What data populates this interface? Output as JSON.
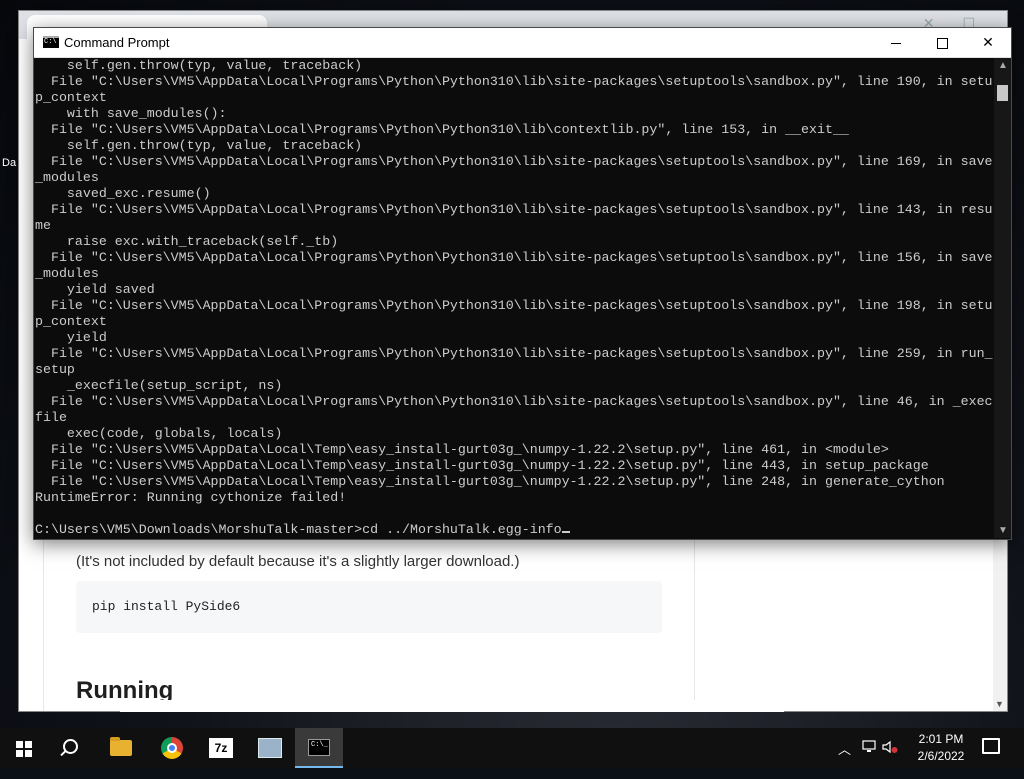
{
  "cmd": {
    "title": "Command Prompt",
    "lines": [
      "    self.gen.throw(typ, value, traceback)",
      "  File \"C:\\Users\\VM5\\AppData\\Local\\Programs\\Python\\Python310\\lib\\site-packages\\setuptools\\sandbox.py\", line 190, in setu",
      "p_context",
      "    with save_modules():",
      "  File \"C:\\Users\\VM5\\AppData\\Local\\Programs\\Python\\Python310\\lib\\contextlib.py\", line 153, in __exit__",
      "    self.gen.throw(typ, value, traceback)",
      "  File \"C:\\Users\\VM5\\AppData\\Local\\Programs\\Python\\Python310\\lib\\site-packages\\setuptools\\sandbox.py\", line 169, in save",
      "_modules",
      "    saved_exc.resume()",
      "  File \"C:\\Users\\VM5\\AppData\\Local\\Programs\\Python\\Python310\\lib\\site-packages\\setuptools\\sandbox.py\", line 143, in resu",
      "me",
      "    raise exc.with_traceback(self._tb)",
      "  File \"C:\\Users\\VM5\\AppData\\Local\\Programs\\Python\\Python310\\lib\\site-packages\\setuptools\\sandbox.py\", line 156, in save",
      "_modules",
      "    yield saved",
      "  File \"C:\\Users\\VM5\\AppData\\Local\\Programs\\Python\\Python310\\lib\\site-packages\\setuptools\\sandbox.py\", line 198, in setu",
      "p_context",
      "    yield",
      "  File \"C:\\Users\\VM5\\AppData\\Local\\Programs\\Python\\Python310\\lib\\site-packages\\setuptools\\sandbox.py\", line 259, in run_",
      "setup",
      "    _execfile(setup_script, ns)",
      "  File \"C:\\Users\\VM5\\AppData\\Local\\Programs\\Python\\Python310\\lib\\site-packages\\setuptools\\sandbox.py\", line 46, in _exec",
      "file",
      "    exec(code, globals, locals)",
      "  File \"C:\\Users\\VM5\\AppData\\Local\\Temp\\easy_install-gurt03g_\\numpy-1.22.2\\setup.py\", line 461, in <module>",
      "  File \"C:\\Users\\VM5\\AppData\\Local\\Temp\\easy_install-gurt03g_\\numpy-1.22.2\\setup.py\", line 443, in setup_package",
      "  File \"C:\\Users\\VM5\\AppData\\Local\\Temp\\easy_install-gurt03g_\\numpy-1.22.2\\setup.py\", line 248, in generate_cython",
      "RuntimeError: Running cythonize failed!",
      ""
    ],
    "prompt": "C:\\Users\\VM5\\Downloads\\MorshuTalk-master>cd ../MorshuTalk.egg-info"
  },
  "browser": {
    "note": "(It's not included by default because it's a slightly larger download.)",
    "code": "pip install PySide6",
    "heading": "Running"
  },
  "desktop": {
    "icon_label_partial": "Da"
  },
  "taskbar": {
    "zip_label": "7z",
    "time": "2:01 PM",
    "date": "2/6/2022"
  },
  "colors": {
    "taskbar_bg": "#101010",
    "console_bg": "#0c0c0c",
    "console_text": "#cccccc",
    "active_indicator": "#76b9ed"
  }
}
